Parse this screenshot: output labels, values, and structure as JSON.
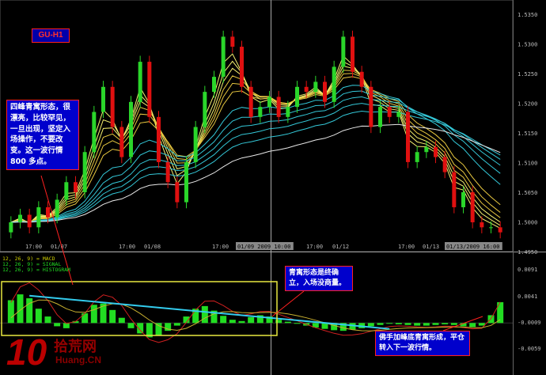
{
  "symbol_tag": "GU-H1",
  "price_axis": {
    "labels": [
      "1.5350",
      "1.5300",
      "1.5250",
      "1.5200",
      "1.5150",
      "1.5100",
      "1.5050",
      "1.5000",
      "1.4950"
    ]
  },
  "time_axis": {
    "labels": [
      "17:00",
      "01/07",
      "17:00",
      "01/08",
      "17:00",
      "01/09 2009 10:00",
      "17:00",
      "01/12",
      "17:00",
      "01/13",
      "01/13/2009 16:00"
    ]
  },
  "macd_axis": {
    "labels": [
      "0.0091",
      "0.0041",
      "-0.0009",
      "-0.0059"
    ]
  },
  "macd_legend": {
    "line1": "12, 26, 9) = MACD",
    "line2": "12, 26, 9) = SIGNAL",
    "line3": "12, 26, 9) = HISTOGRAM"
  },
  "annotations": {
    "main": "四峰青寓形态，很漂亮，比较罕见，一旦出现，坚定入场操作，不要改变。这一波行情 800 多点。",
    "confirm": "青寓形态是终确立，入场没商量。",
    "next": "佛手加峰底青寓形成，平仓转入下一波行情。"
  },
  "logo": {
    "number": "10",
    "text_cn": "拾荒网",
    "url": "Huang.CN"
  },
  "colors": {
    "background": "#000000",
    "bull_candle": "#2ad62a",
    "bear_candle": "#e01010",
    "histogram": "#22dd22",
    "trendline": "#33ccee",
    "box": "#e8e840",
    "callout_bg": "#0000cc",
    "callout_border": "#ff2020"
  },
  "chart_data": {
    "type": "candlestick",
    "y_range": [
      1.493,
      1.54
    ],
    "macd_range": [
      -0.0075,
      0.01
    ],
    "closes": [
      1.496,
      1.4975,
      1.495,
      1.499,
      1.497,
      1.5005,
      1.504,
      1.502,
      1.51,
      1.518,
      1.523,
      1.515,
      1.509,
      1.52,
      1.528,
      1.517,
      1.508,
      1.504,
      1.5,
      1.508,
      1.515,
      1.522,
      1.525,
      1.533,
      1.531,
      1.523,
      1.517,
      1.519,
      1.521,
      1.517,
      1.519,
      1.523,
      1.522,
      1.524,
      1.52,
      1.527,
      1.533,
      1.526,
      1.523,
      1.515,
      1.519,
      1.517,
      1.518,
      1.508,
      1.51,
      1.511,
      1.509,
      1.506,
      1.499,
      1.502,
      1.496,
      1.495,
      1.495,
      1.494
    ],
    "histogram": [
      0.0035,
      0.0044,
      0.0038,
      0.0022,
      0.001,
      -0.0005,
      -0.0008,
      0.0003,
      0.0015,
      0.0028,
      0.003,
      0.002,
      0.0008,
      -0.0008,
      -0.0016,
      -0.0022,
      -0.0019,
      -0.0012,
      -0.0004,
      0.001,
      0.0022,
      0.0026,
      0.0019,
      0.0011,
      0.0005,
      0.0003,
      0.0009,
      0.0012,
      0.001,
      0.0005,
      0.0002,
      -0.0001,
      -0.0004,
      -0.0007,
      -0.0009,
      -0.0011,
      -0.0012,
      -0.001,
      -0.0008,
      -0.0005,
      -0.0003,
      -0.0001,
      -0.0002,
      -0.0003,
      -0.0004,
      -0.0004,
      -0.0003,
      -0.0002,
      -0.0003,
      -0.0005,
      -0.0006,
      -0.0004,
      0.0012,
      0.0032
    ],
    "ma_last": [
      1.495,
      1.496,
      1.4975,
      1.499,
      1.501,
      1.504,
      1.508,
      1.512
    ],
    "trendline": {
      "start": [
        2,
        0.0042
      ],
      "end": [
        41,
        -0.0009
      ]
    },
    "grid": false
  }
}
